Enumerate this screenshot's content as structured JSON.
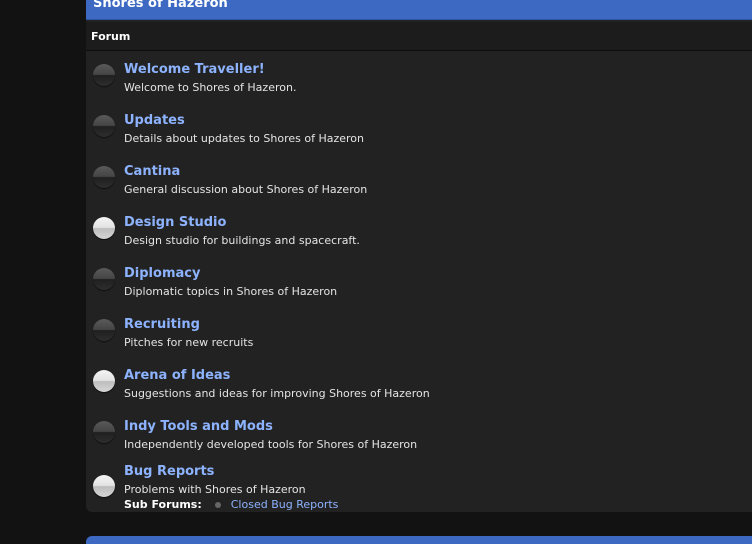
{
  "category": {
    "title": "Shores of Hazeron"
  },
  "columns": {
    "forum": "Forum"
  },
  "forums": [
    {
      "title": "Welcome Traveller!",
      "description": "Welcome to Shores of Hazeron.",
      "icon": "forum-read-icon"
    },
    {
      "title": "Updates",
      "description": "Details about updates to Shores of Hazeron",
      "icon": "forum-read-icon"
    },
    {
      "title": "Cantina",
      "description": "General discussion about Shores of Hazeron",
      "icon": "forum-read-icon"
    },
    {
      "title": "Design Studio",
      "description": "Design studio for buildings and spacecraft.",
      "icon": "forum-unread-icon"
    },
    {
      "title": "Diplomacy",
      "description": "Diplomatic topics in Shores of Hazeron",
      "icon": "forum-read-icon"
    },
    {
      "title": "Recruiting",
      "description": "Pitches for new recruits",
      "icon": "forum-read-icon"
    },
    {
      "title": "Arena of Ideas",
      "description": "Suggestions and ideas for improving Shores of Hazeron",
      "icon": "forum-unread-icon"
    },
    {
      "title": "Indy Tools and Mods",
      "description": "Independently developed tools for Shores of Hazeron",
      "icon": "forum-read-icon"
    },
    {
      "title": "Bug Reports",
      "description": "Problems with Shores of Hazeron",
      "icon": "forum-unread-icon",
      "subforums": {
        "label": "Sub Forums:",
        "items": [
          "Closed Bug Reports"
        ]
      }
    }
  ],
  "colors": {
    "header": "#3d69c3",
    "link": "#8db3ff",
    "panel": "#222222",
    "background": "#121212"
  }
}
